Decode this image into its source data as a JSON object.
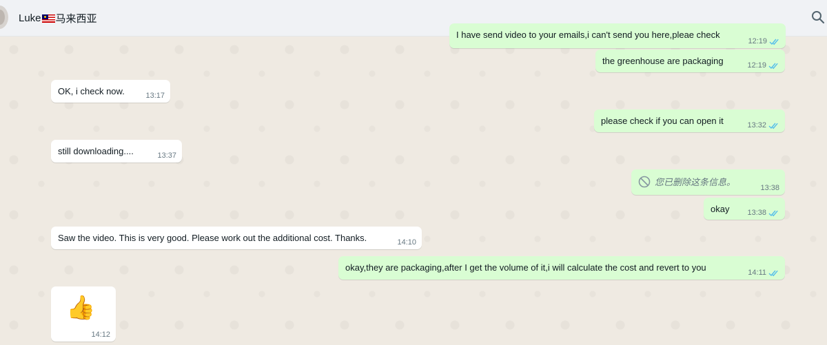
{
  "header": {
    "contact_name": "Luke",
    "contact_suffix": "马来西亚"
  },
  "icons": {
    "search": "search-icon",
    "read_receipt": "double-check-icon",
    "deleted": "blocked-icon",
    "flag": "malaysia-flag-icon"
  },
  "colors": {
    "incoming_bubble": "#ffffff",
    "outgoing_bubble": "#d9fdd3",
    "read_tick": "#53bdeb",
    "chat_background": "#efeae2"
  },
  "messages": [
    {
      "dir": "out",
      "text": "I have send video to your emails,i can't send you here,pleae check",
      "time": "12:19",
      "read": true
    },
    {
      "dir": "out",
      "text": "the greenhouse are packaging",
      "time": "12:19",
      "read": true
    },
    {
      "dir": "in",
      "text": "OK, i check now.",
      "time": "13:17"
    },
    {
      "dir": "out",
      "text": "please check if you can open it",
      "time": "13:32",
      "read": true
    },
    {
      "dir": "in",
      "text": "still downloading....",
      "time": "13:37"
    },
    {
      "dir": "out",
      "deleted": true,
      "text": "您已删除这条信息。",
      "time": "13:38"
    },
    {
      "dir": "out",
      "text": "okay",
      "time": "13:38",
      "read": true
    },
    {
      "dir": "in",
      "text": "Saw the video. This is very good. Please work out the additional cost. Thanks.",
      "time": "14:10"
    },
    {
      "dir": "out",
      "text": "okay,they are packaging,after I get the volume of it,i will calculate the cost and revert to you",
      "time": "14:11",
      "read": true
    },
    {
      "dir": "in",
      "emoji": "👍",
      "time": "14:12"
    }
  ]
}
